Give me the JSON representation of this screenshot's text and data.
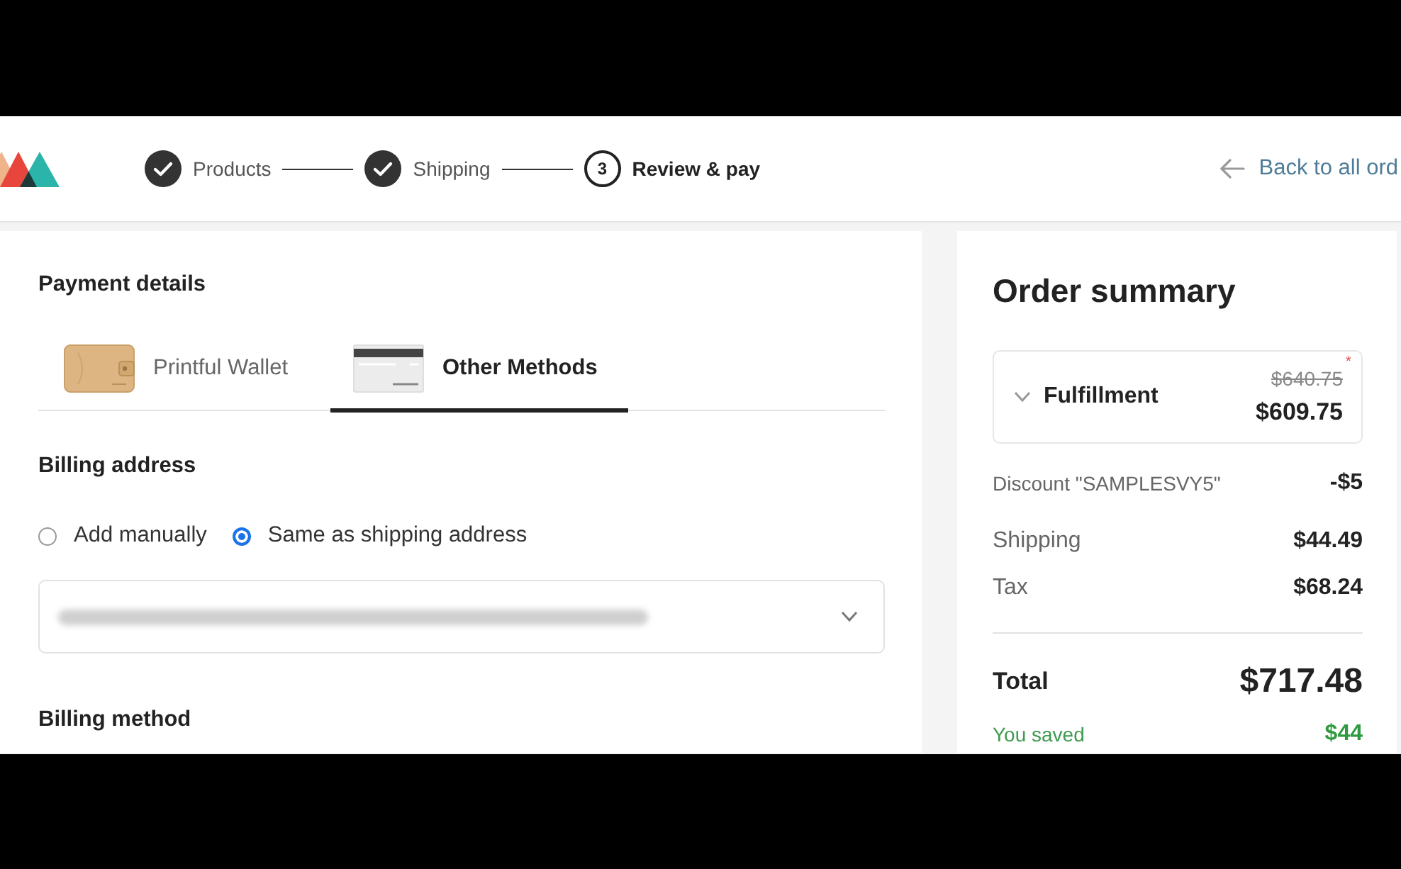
{
  "header": {
    "steps": [
      {
        "label": "Products",
        "completed": true,
        "selected": false
      },
      {
        "label": "Shipping",
        "completed": true,
        "selected": false
      },
      {
        "label": "Review & pay",
        "completed": false,
        "selected": true,
        "number": "3"
      }
    ],
    "back_link": {
      "label": "Back to all ord"
    }
  },
  "payment": {
    "title": "Payment details",
    "tabs": [
      {
        "label": "Printful Wallet",
        "kind": "wallet",
        "selected": false
      },
      {
        "label": "Other Methods",
        "kind": "card",
        "selected": true
      }
    ]
  },
  "billing_address": {
    "title": "Billing address",
    "options": [
      {
        "label": "Add manually",
        "selected": false
      },
      {
        "label": "Same as shipping address",
        "selected": true
      }
    ]
  },
  "billing_method": {
    "title": "Billing method"
  },
  "order_summary": {
    "title": "Order summary",
    "fulfillment": {
      "label": "Fulfillment",
      "original_price": "$640.75",
      "note_mark": "*",
      "price": "$609.75"
    },
    "lines": [
      {
        "label": "Discount \"SAMPLESVY5\"",
        "value": "-$5"
      },
      {
        "label": "Shipping",
        "value": "$44.49"
      },
      {
        "label": "Tax",
        "value": "$68.24"
      }
    ],
    "total": {
      "label": "Total",
      "value": "$717.48"
    },
    "saved": {
      "label": "You saved",
      "value": "$44"
    }
  }
}
